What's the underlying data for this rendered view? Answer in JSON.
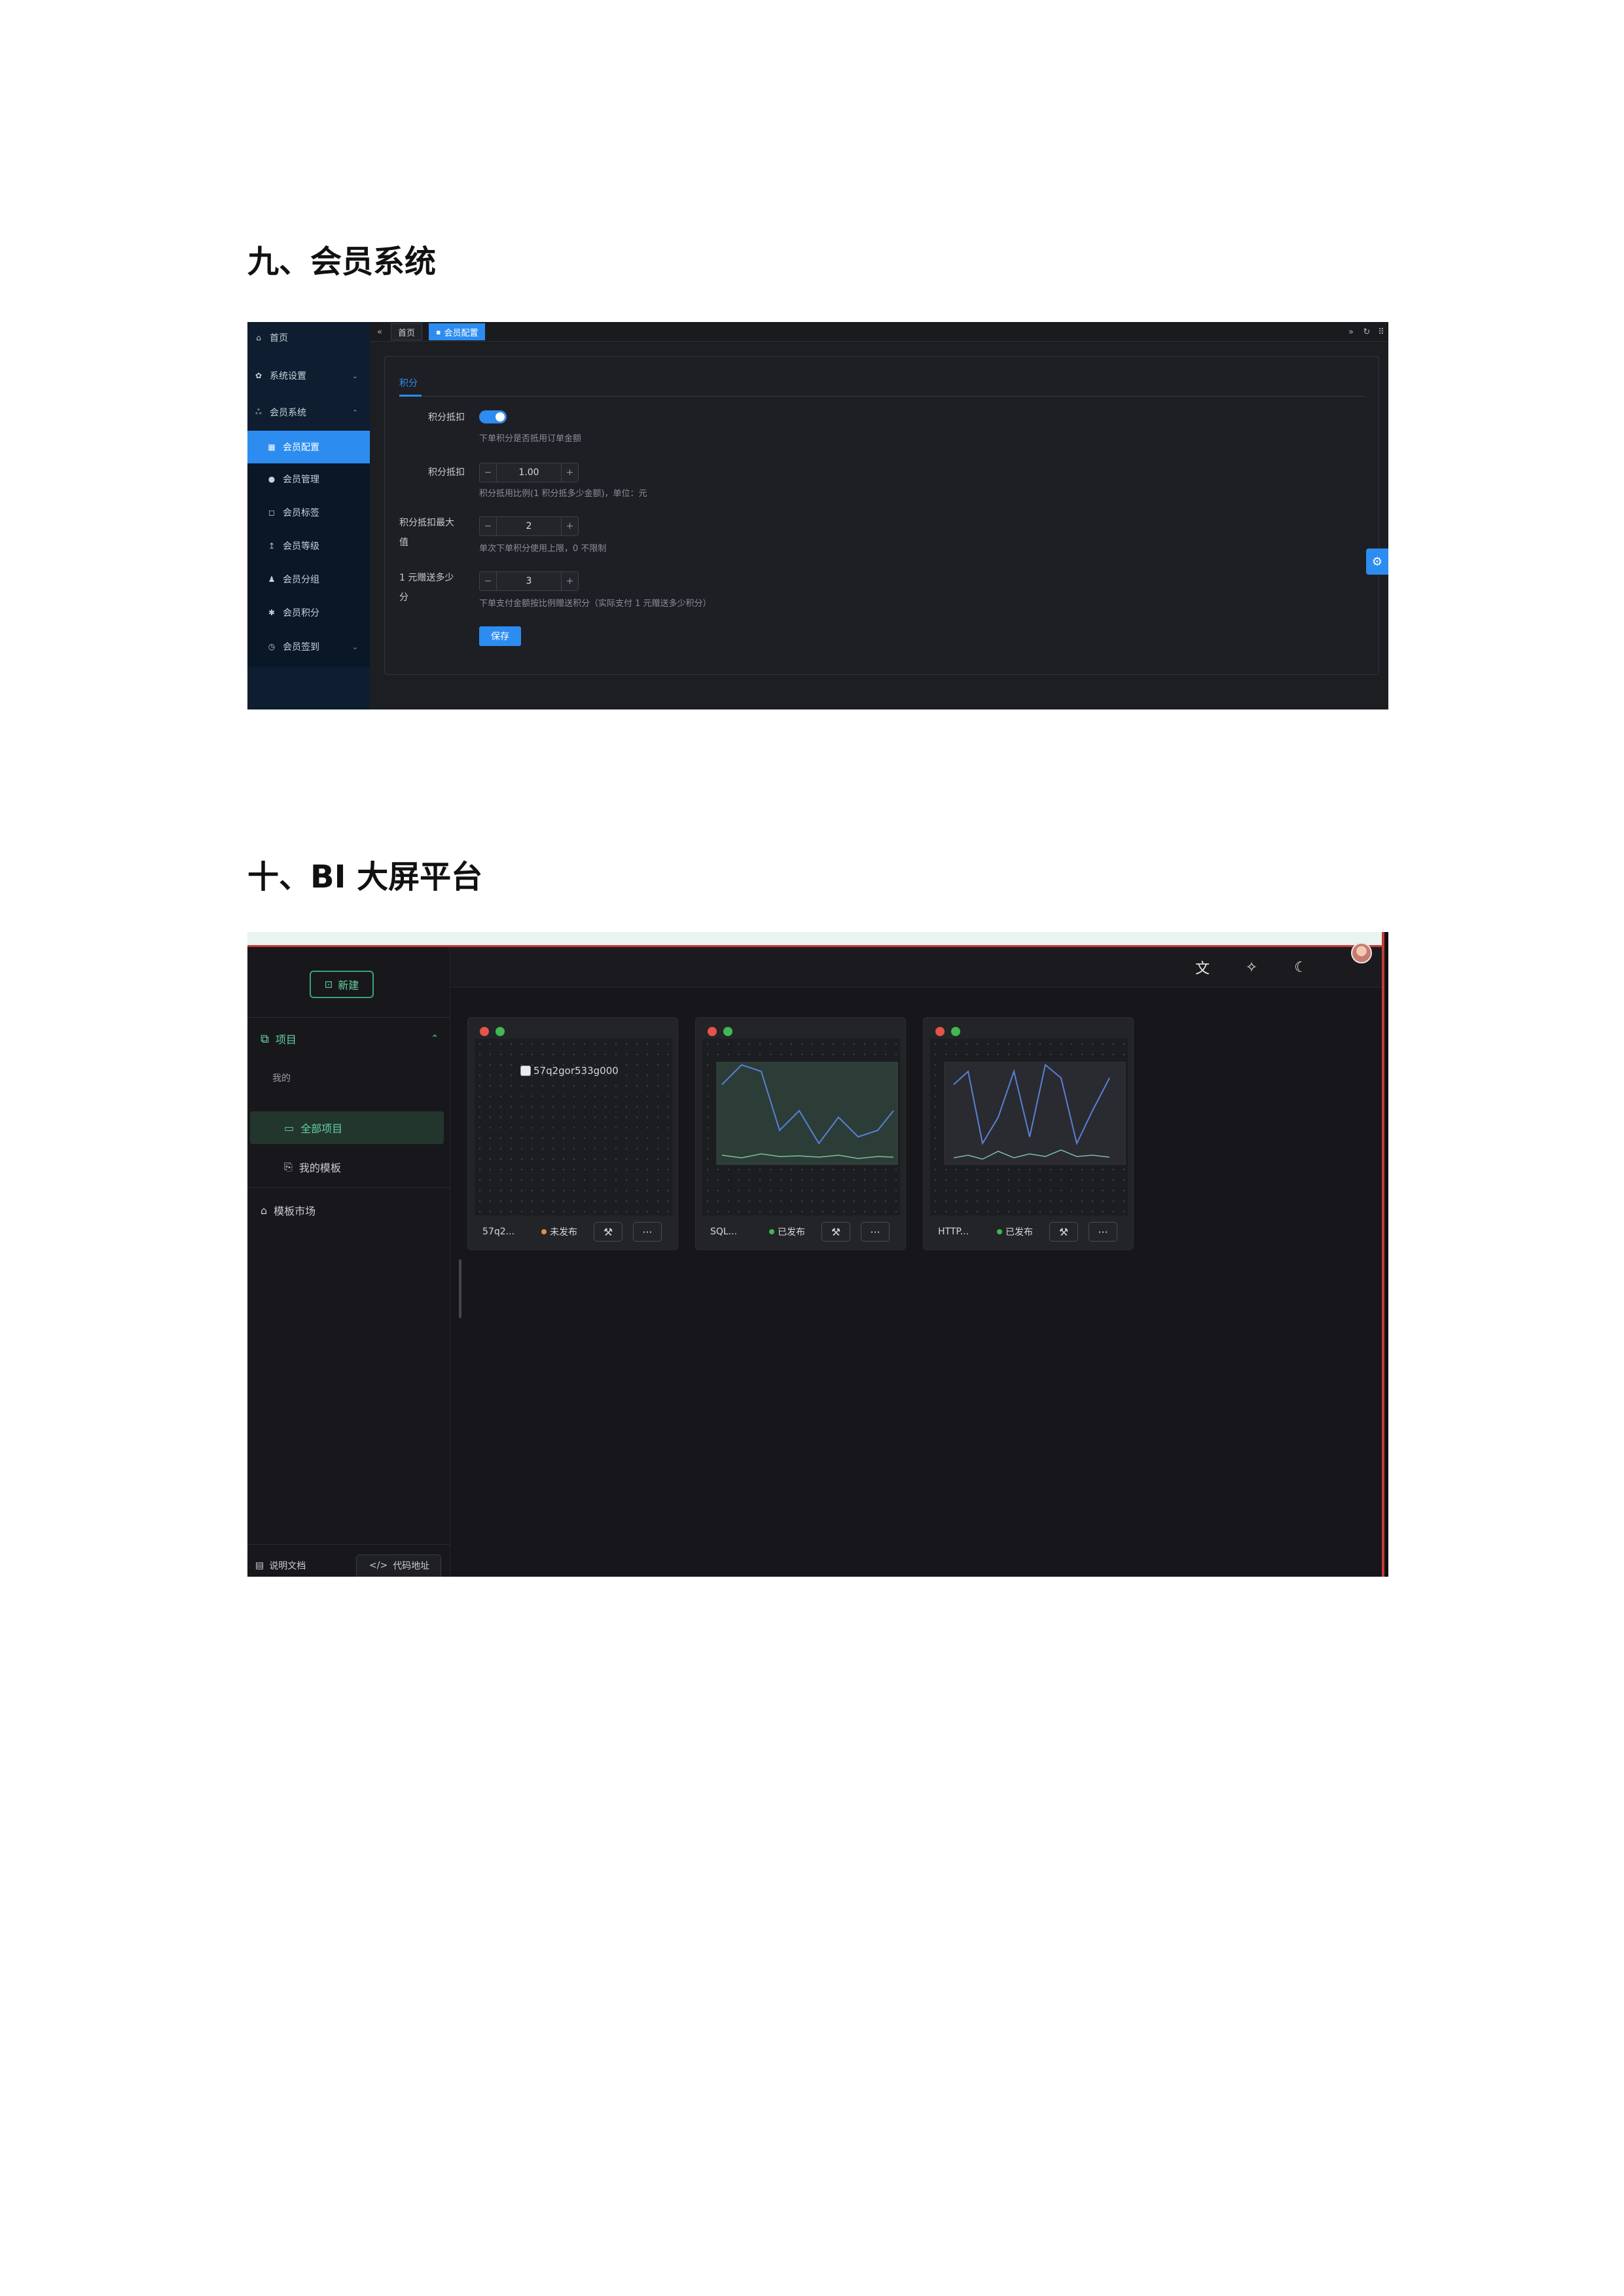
{
  "section1": {
    "heading": "九、会员系统"
  },
  "section2": {
    "heading": "十、BI 大屏平台"
  },
  "member": {
    "sidebar": {
      "items": [
        {
          "label": "首页",
          "icon": "home-icon",
          "glyph": "⌂"
        },
        {
          "label": "系统设置",
          "icon": "gear-icon",
          "glyph": "✿"
        },
        {
          "label": "会员系统",
          "icon": "users-icon",
          "glyph": "ஃ"
        }
      ],
      "sub_items": [
        {
          "label": "会员配置",
          "icon": "grid-icon",
          "glyph": "▦"
        },
        {
          "label": "会员管理",
          "icon": "user-icon",
          "glyph": "●"
        },
        {
          "label": "会员标签",
          "icon": "bookmark-icon",
          "glyph": "◻"
        },
        {
          "label": "会员等级",
          "icon": "level-icon",
          "glyph": "↥"
        },
        {
          "label": "会员分组",
          "icon": "group-icon",
          "glyph": "♟"
        },
        {
          "label": "会员积分",
          "icon": "star-icon",
          "glyph": "✱"
        },
        {
          "label": "会员签到",
          "icon": "alarm-icon",
          "glyph": "◷"
        }
      ]
    },
    "tabs": {
      "home": "首页",
      "active": "会员配置",
      "left_arrow": "«",
      "right_arrow": "»",
      "refresh": "↻",
      "grid": "⠿"
    },
    "card_tab": "积分",
    "form": {
      "toggle_label": "积分抵扣",
      "toggle_on": true,
      "toggle_help": "下单积分是否抵用订单金额",
      "ratio_label": "积分抵扣",
      "ratio_value": "1.00",
      "ratio_help": "积分抵用比例(1 积分抵多少金额)，单位：元",
      "max_label_1": "积分抵扣最大",
      "max_label_2": "值",
      "max_value": "2",
      "max_help": "单次下单积分使用上限，0 不限制",
      "give_label_1": "1 元赠送多少",
      "give_label_2": "分",
      "give_value": "3",
      "give_help": "下单支付金额按比例赠送积分（实际支付 1 元赠送多少积分）",
      "minus": "−",
      "plus": "+",
      "save": "保存"
    },
    "colors": {
      "accent": "#2d8cf0",
      "sidebar": "#0e1d2f"
    }
  },
  "bi": {
    "new_button": "新建",
    "menu": {
      "projects": "项目",
      "mine": "我的",
      "all_projects": "全部项目",
      "my_templates": "我的模板",
      "template_market": "模板市场"
    },
    "footer": {
      "docs": "说明文档",
      "code": "代码地址"
    },
    "header_icons": [
      "translate-icon",
      "magic-wand-icon",
      "moon-icon",
      "avatar"
    ],
    "cards": [
      {
        "name": "57q2...",
        "status": "未发布",
        "status_color": "#e0923a",
        "image_alt": "57q2gor533g000"
      },
      {
        "name": "SQL...",
        "status": "已发布",
        "status_color": "#3fb950"
      },
      {
        "name": "HTTP...",
        "status": "已发布",
        "status_color": "#3fb950"
      }
    ],
    "colors": {
      "accent": "#63d19f",
      "bg": "#17171b"
    }
  }
}
